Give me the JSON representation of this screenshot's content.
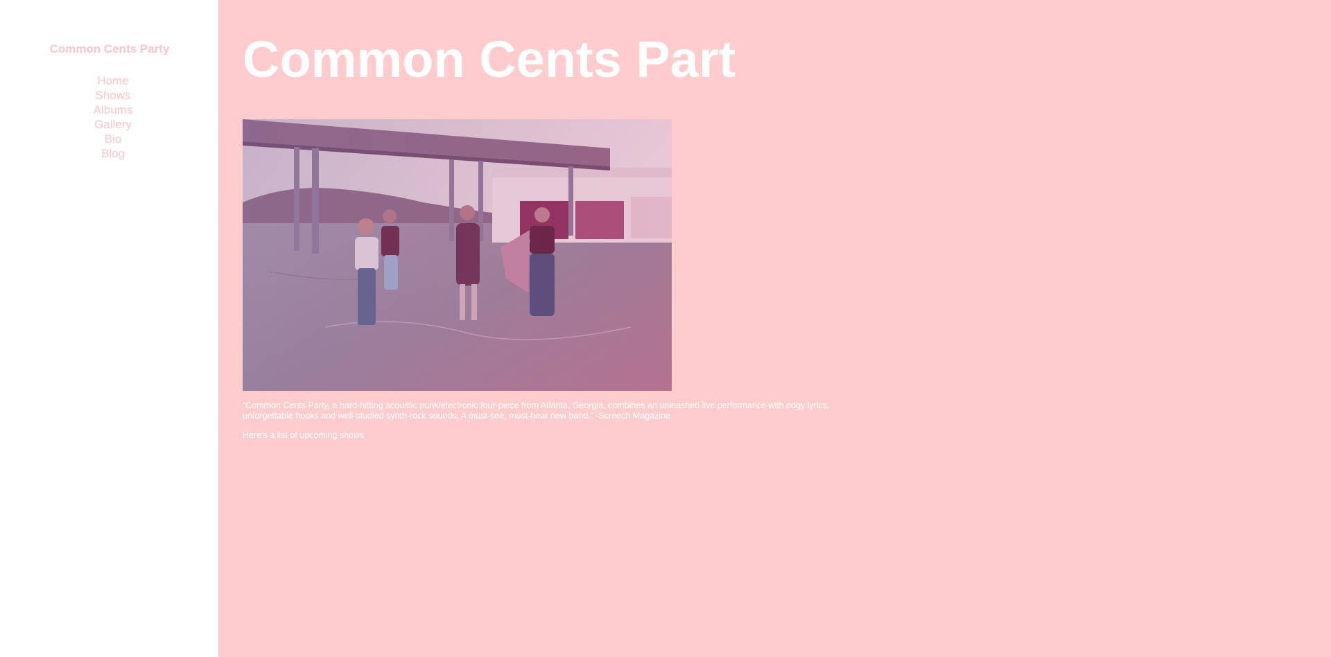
{
  "sidebar": {
    "title": "Common Cents Party",
    "nav": [
      {
        "label": "Home"
      },
      {
        "label": "Shows"
      },
      {
        "label": "Albums"
      },
      {
        "label": "Gallery"
      },
      {
        "label": "Bio"
      },
      {
        "label": "Blog"
      }
    ]
  },
  "main": {
    "title": "Common Cents Part",
    "photo_alt": "band-photo",
    "quote": "“Common Cents Party, a hard-hitting acoustic punk/electronic four-piece from Atlanta, Georgia, combines an unleashed live performance with edgy lyrics, unforgettable hooks and well-studied synth-rock sounds. A must-see, must-hear new band.” -Screech Magazine",
    "shows_intro": "Here's a list of upcoming shows"
  },
  "colors": {
    "page_background": "#fecccd",
    "sidebar_background": "#ffffff",
    "sidebar_text": "#fbc6c8",
    "main_text": "#ffffff"
  }
}
